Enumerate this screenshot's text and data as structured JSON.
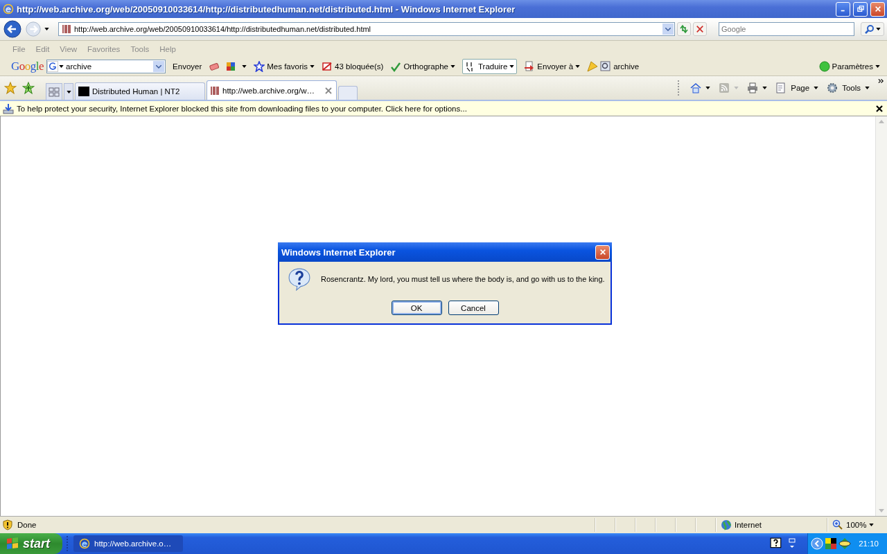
{
  "window": {
    "title": "http://web.archive.org/web/20050910033614/http://distributedhuman.net/distributed.html - Windows Internet Explorer"
  },
  "address_bar": {
    "url": "http://web.archive.org/web/20050910033614/http://distributedhuman.net/distributed.html"
  },
  "search_field": {
    "placeholder": "Google"
  },
  "menu": [
    "File",
    "Edit",
    "View",
    "Favorites",
    "Tools",
    "Help"
  ],
  "google_toolbar": {
    "logo": "Google",
    "search_value": "archive",
    "items": [
      {
        "kind": "text",
        "label": "Envoyer"
      },
      {
        "kind": "icons"
      },
      {
        "kind": "star",
        "label": "Mes favoris"
      },
      {
        "kind": "blocked",
        "label": "43 bloquée(s)"
      },
      {
        "kind": "spell",
        "label": "Orthographe"
      },
      {
        "kind": "translate",
        "label": "Traduire"
      },
      {
        "kind": "send",
        "label": "Envoyer à"
      },
      {
        "kind": "search",
        "label": "archive"
      }
    ],
    "settings": "Paramètres"
  },
  "tabs": [
    {
      "label": "Distributed Human | NT2",
      "selected": false,
      "kind": "nt2"
    },
    {
      "label": "http://web.archive.org/w…",
      "selected": true,
      "kind": "archive"
    }
  ],
  "command_bar": [
    "Page",
    "Tools"
  ],
  "info_bar": {
    "text": "To help protect your security, Internet Explorer blocked this site from downloading files to your computer. Click here for options..."
  },
  "dialog": {
    "title": "Windows Internet Explorer",
    "message": "Rosencrantz. My lord, you must tell us where the body is, and go with us to the king.",
    "buttons": [
      {
        "label": "OK",
        "default": true
      },
      {
        "label": "Cancel",
        "default": false
      }
    ]
  },
  "status_bar": {
    "text": "Done",
    "zone": "Internet",
    "zoom": "100%"
  },
  "taskbar": {
    "start": "start",
    "window": "http://web.archive.o…",
    "clock": "21:10"
  }
}
